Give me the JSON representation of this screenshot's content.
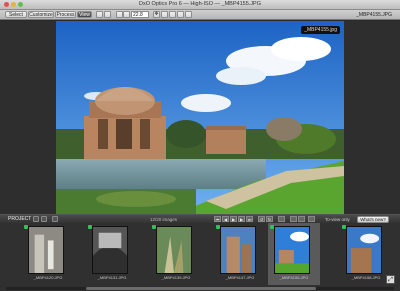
{
  "window": {
    "title": "DxO Optics Pro 6 — High-ISO — _MBP4155.JPG"
  },
  "toolbar": {
    "select_label": "Select",
    "customize_label": "Customize",
    "process_label": "Process",
    "view_label": "View",
    "zoom_value": "22.8",
    "current_file": "_MBP4155.JPG"
  },
  "viewer": {
    "photo_tag": "_MBP4155.jpg",
    "photo_subject": "Palace of Fine Arts with lagoon, trees and lawn under blue sky"
  },
  "project_bar": {
    "label": "PROJECT",
    "image_count": "12/20 images",
    "howto_label": "To-view only",
    "whatsnew_label": "What's new?"
  },
  "filmstrip": {
    "items": [
      {
        "label": "_MBP4120.JPG",
        "selected": false
      },
      {
        "label": "_MBP4131.JPG",
        "selected": false
      },
      {
        "label": "_MBP4139.JPG",
        "selected": false
      },
      {
        "label": "_MBP4147.JPG",
        "selected": false
      },
      {
        "label": "_MBP4155.JPG",
        "selected": true
      },
      {
        "label": "_MBP4158.JPG",
        "selected": false
      }
    ]
  },
  "colors": {
    "sky": "#2f7fd8",
    "grass": "#55a62e",
    "badge_green": "#2fc45a"
  }
}
